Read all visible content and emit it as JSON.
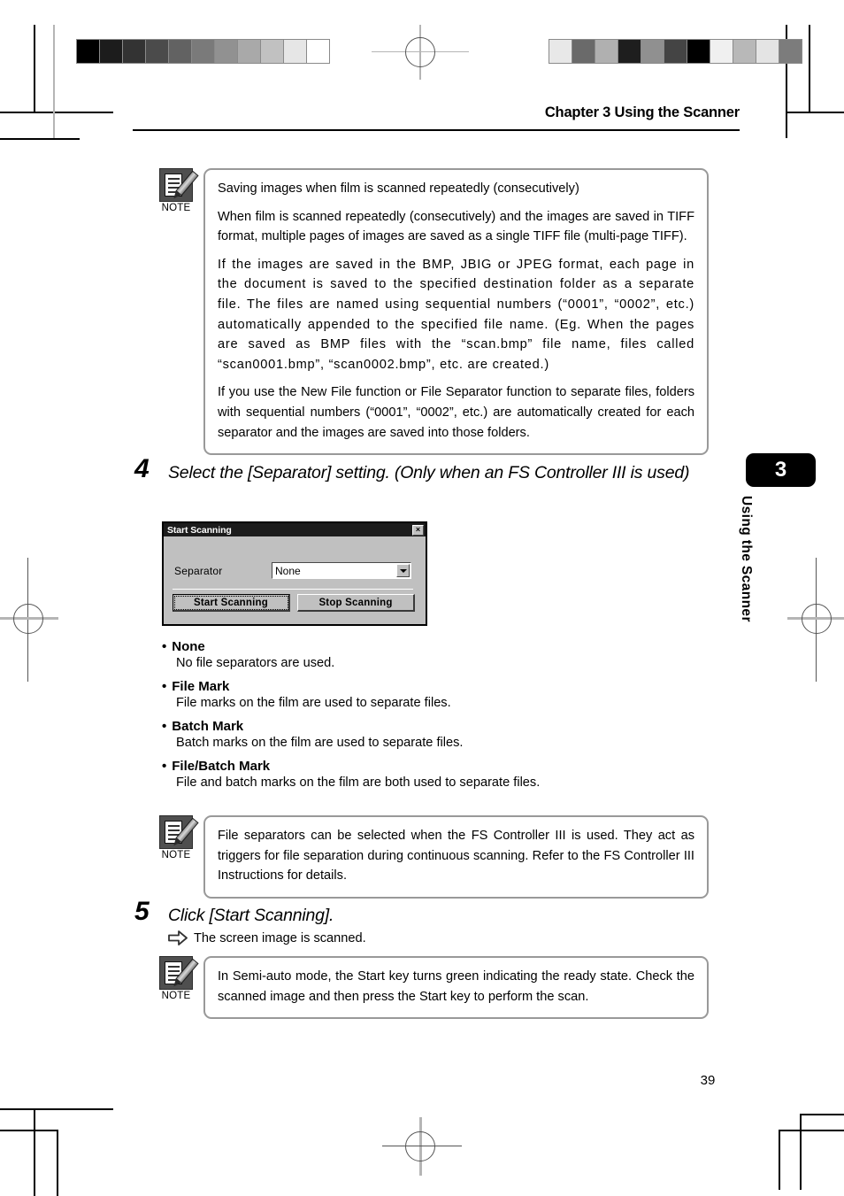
{
  "document": {
    "header_title": "Chapter 3 Using the Scanner",
    "page_number": "39",
    "side_tab_number": "3",
    "side_tab_label": "Using the Scanner"
  },
  "note_top": {
    "icon_caption": "NOTE",
    "paragraphs": [
      "Saving images when film is scanned repeatedly (consecutively)",
      "When film is scanned repeatedly (consecutively) and the images are saved in TIFF format, multiple pages of images are saved as a single TIFF file (multi-page TIFF).",
      "If the images are saved in the BMP, JBIG or JPEG format, each page in the document is saved to the specified destination folder as a separate file. The files are named using sequential numbers (“0001”, “0002”, etc.) automatically appended to the specified file name. (Eg. When the pages are saved as BMP files with the “scan.bmp” file name, files called “scan0001.bmp”, “scan0002.bmp”, etc. are created.)",
      "If you use the New File function or File Separator function to separate files, folders with sequential numbers (“0001”, “0002”, etc.) are automatically created for each separator and the images are saved into those folders."
    ]
  },
  "step4": {
    "number": "4",
    "title": "Select the [Separator] setting. (Only when an FS Controller III is used)"
  },
  "dialog": {
    "title": "Start Scanning",
    "close_label": "×",
    "separator_label": "Separator",
    "separator_value": "None",
    "start_button": "Start Scanning",
    "stop_button": "Stop Scanning"
  },
  "options": [
    {
      "bullet": "•",
      "term": "None",
      "desc": "No file separators are used."
    },
    {
      "bullet": "•",
      "term": "File Mark",
      "desc": "File marks on the film are used to separate files."
    },
    {
      "bullet": "•",
      "term": "Batch Mark",
      "desc": "Batch marks on the film are used to separate files."
    },
    {
      "bullet": "•",
      "term": "File/Batch Mark",
      "desc": "File and batch marks on the film are both used to separate files."
    }
  ],
  "note_middle": {
    "icon_caption": "NOTE",
    "paragraphs": [
      "File separators can be selected when the FS Controller III is used. They act as triggers for file separation during continuous scanning. Refer to the FS Controller III Instructions for details."
    ]
  },
  "step5": {
    "number": "5",
    "title": "Click [Start Scanning].",
    "result": "The screen image is scanned."
  },
  "note_bottom": {
    "icon_caption": "NOTE",
    "paragraphs": [
      "In Semi-auto mode, the Start key turns green indicating the ready state. Check the scanned image and then press the Start key to perform the scan."
    ]
  },
  "calibration": {
    "left_wedge": [
      "#000000",
      "#1c1c1c",
      "#333333",
      "#4b4b4b",
      "#626262",
      "#7a7a7a",
      "#919191",
      "#a9a9a9",
      "#c1c1c1",
      "#e6e6e6",
      "#ffffff"
    ],
    "right_wedge": [
      "#e8e8e8",
      "#6a6a6a",
      "#b0b0b0",
      "#1e1e1e",
      "#909090",
      "#444444",
      "#000000",
      "#f0f0f0",
      "#b8b8b8",
      "#e4e4e4",
      "#7c7c7c"
    ]
  }
}
